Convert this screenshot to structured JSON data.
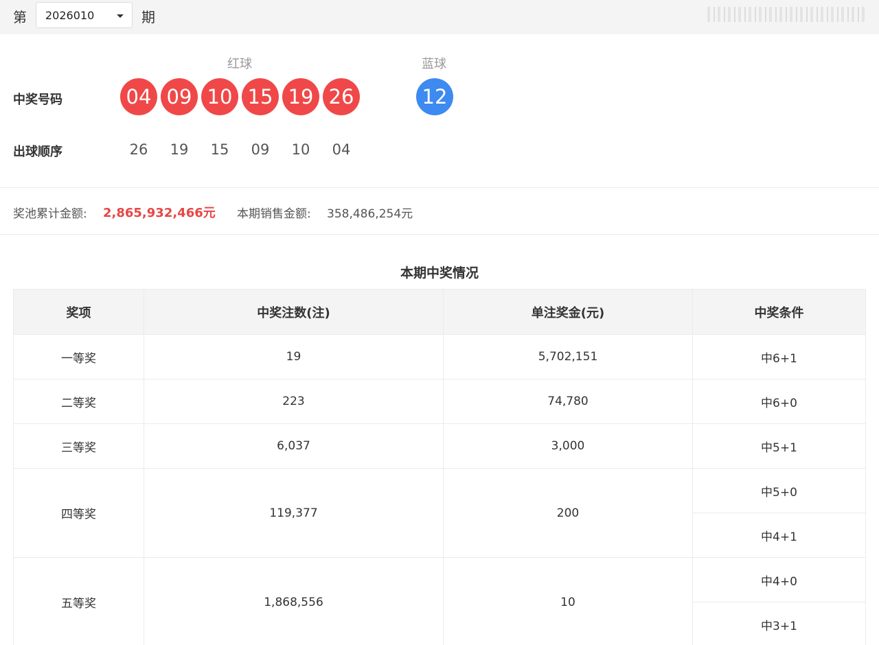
{
  "issue": {
    "prefix": "第",
    "suffix": "期",
    "selected": "2026010"
  },
  "draw": {
    "red_label": "红球",
    "blue_label": "蓝球",
    "numbers_label": "中奖号码",
    "order_label": "出球顺序",
    "red_balls": [
      "04",
      "09",
      "10",
      "15",
      "19",
      "26"
    ],
    "blue_ball": "12",
    "order": [
      "26",
      "19",
      "15",
      "09",
      "10",
      "04"
    ],
    "colors": {
      "red": "#f04848",
      "blue": "#3d8af0"
    }
  },
  "money": {
    "pool_label": "奖池累计金额:",
    "pool_value": "2,865,932,466元",
    "sales_label": "本期销售金额:",
    "sales_value": "358,486,254元",
    "highlight_color": "#e84545"
  },
  "prizes": {
    "title": "本期中奖情况",
    "headers": [
      "奖项",
      "中奖注数(注)",
      "单注奖金(元)",
      "中奖条件"
    ],
    "rows": [
      {
        "name": "一等奖",
        "count": "19",
        "amount": "5,702,151",
        "conditions": [
          "中6+1"
        ]
      },
      {
        "name": "二等奖",
        "count": "223",
        "amount": "74,780",
        "conditions": [
          "中6+0"
        ]
      },
      {
        "name": "三等奖",
        "count": "6,037",
        "amount": "3,000",
        "conditions": [
          "中5+1"
        ]
      },
      {
        "name": "四等奖",
        "count": "119,377",
        "amount": "200",
        "conditions": [
          "中5+0",
          "中4+1"
        ]
      },
      {
        "name": "五等奖",
        "count": "1,868,556",
        "amount": "10",
        "conditions": [
          "中4+0",
          "中3+1"
        ]
      }
    ]
  }
}
